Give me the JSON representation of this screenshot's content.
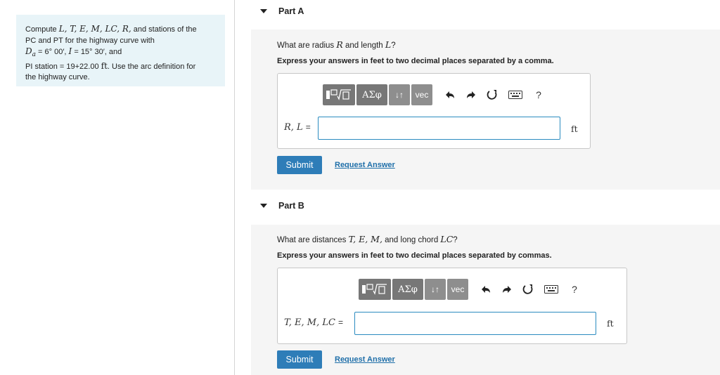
{
  "problem": {
    "line1_text": "Compute ",
    "line1_math": "L, T, E, M, LC, R,",
    "line1_end": " and stations of the",
    "line2": "PC and PT for the highway curve with",
    "line3_math1": "D",
    "line3_sub": "a",
    "line3_eq1": " = 6° 00′, ",
    "line3_math2": "I",
    "line3_eq2": " = 15° 30′, and",
    "line4_text": "PI station = 19+22.00 ",
    "line4_unit": "ft",
    "line4_end": ". Use the arc definition for",
    "line5": "the highway curve."
  },
  "partA": {
    "title": "Part A",
    "q_pre": "What are radius ",
    "q_m1": "R",
    "q_mid": " and length ",
    "q_m2": "L",
    "q_end": "?",
    "instruction": "Express your answers in feet to two decimal places separated by a comma.",
    "input_label": "R, L",
    "eq": "=",
    "input_value": "",
    "unit": "ft",
    "submit": "Submit",
    "request": "Request Answer"
  },
  "partB": {
    "title": "Part B",
    "q_pre": "What are distances ",
    "q_m1": "T, E, M,",
    "q_mid": " and long chord ",
    "q_m2": "LC",
    "q_end": "?",
    "instruction": "Express your answers in feet to two decimal places separated by commas.",
    "input_label": "T, E, M, LC",
    "eq": "=",
    "input_value": "",
    "unit": "ft",
    "submit": "Submit",
    "request": "Request Answer"
  },
  "toolbar": {
    "greek": "ΑΣφ",
    "arrows": "↓↑",
    "vec": "vec",
    "help": "?"
  }
}
